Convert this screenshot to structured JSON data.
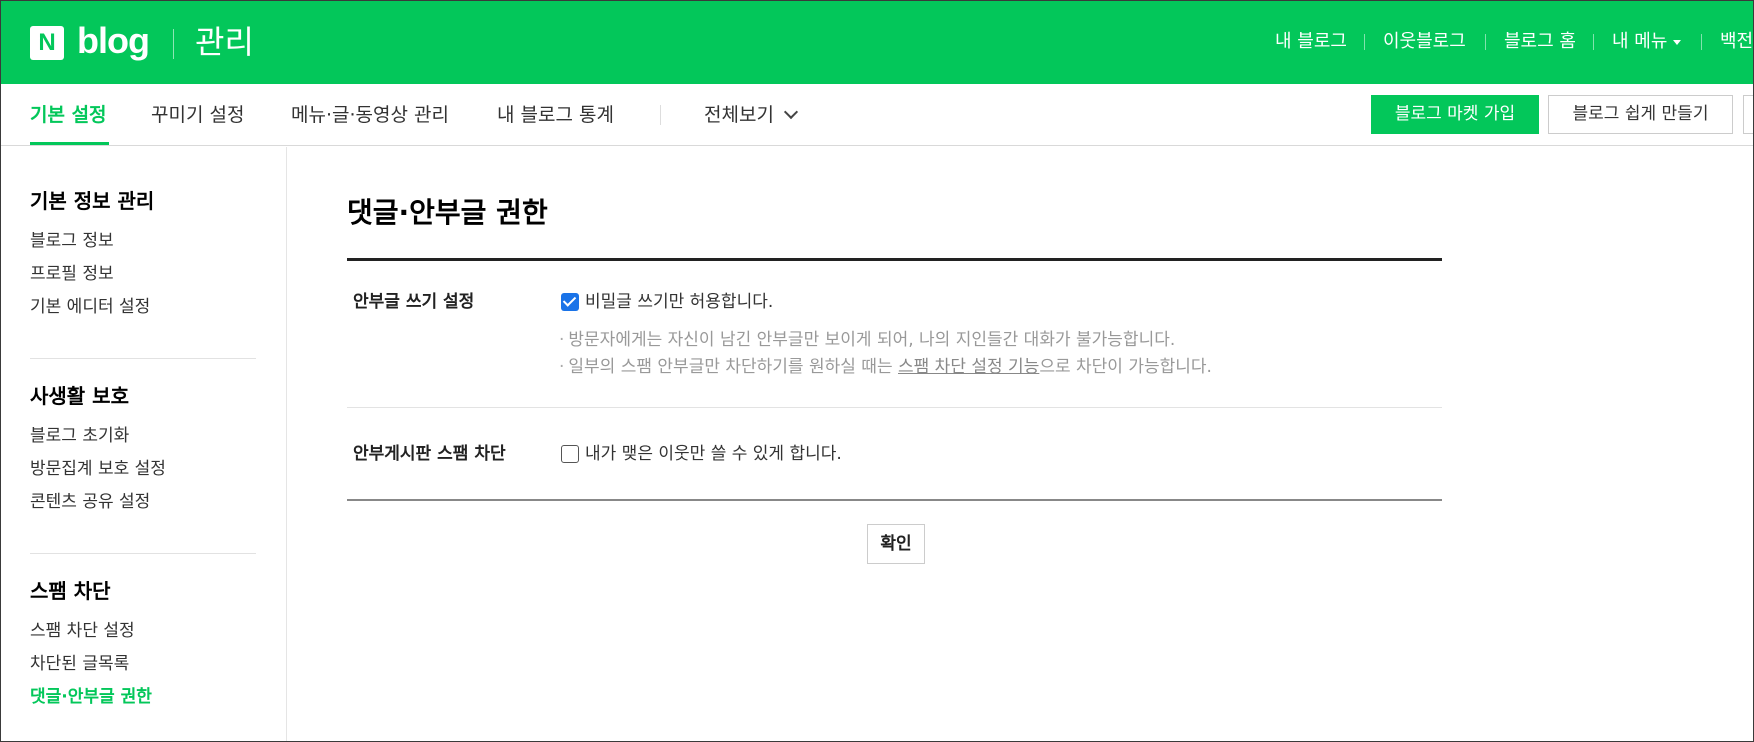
{
  "header": {
    "logo_mark": "N",
    "logo_text": "blog",
    "section_title": "관리",
    "nav": [
      "내 블로그",
      "이웃블로그",
      "블로그 홈",
      "내 메뉴",
      "백전"
    ]
  },
  "tabs": {
    "items": [
      "기본 설정",
      "꾸미기 설정",
      "메뉴·글·동영상 관리",
      "내 블로그 통계"
    ],
    "view_all": "전체보기",
    "market_button": "블로그 마켓 가입",
    "easy_button": "블로그 쉽게 만들기"
  },
  "sidebar": {
    "sections": [
      {
        "title": "기본 정보 관리",
        "items": [
          "블로그 정보",
          "프로필 정보",
          "기본 에디터 설정"
        ]
      },
      {
        "title": "사생활 보호",
        "items": [
          "블로그 초기화",
          "방문집계 보호 설정",
          "콘텐츠 공유 설정"
        ]
      },
      {
        "title": "스팸 차단",
        "items": [
          "스팸 차단 설정",
          "차단된 글목록",
          "댓글·안부글 권한"
        ]
      }
    ]
  },
  "main": {
    "title": "댓글·안부글 권한",
    "rows": [
      {
        "label": "안부글 쓰기 설정",
        "option": "비밀글 쓰기만 허용합니다.",
        "checked": true,
        "note1": "방문자에게는 자신이 남긴 안부글만 보이게 되어, 나의 지인들간 대화가 불가능합니다.",
        "note2_pre": "일부의 스팸 안부글만 차단하기를 원하실 때는 ",
        "note2_link": "스팸 차단 설정 기능",
        "note2_post": "으로 차단이 가능합니다."
      },
      {
        "label": "안부게시판 스팸 차단",
        "option": "내가 맺은 이웃만 쓸 수 있게 합니다.",
        "checked": false
      }
    ],
    "confirm": "확인"
  },
  "colors": {
    "brand": "#03c75a",
    "checkbox": "#1a73e8"
  }
}
